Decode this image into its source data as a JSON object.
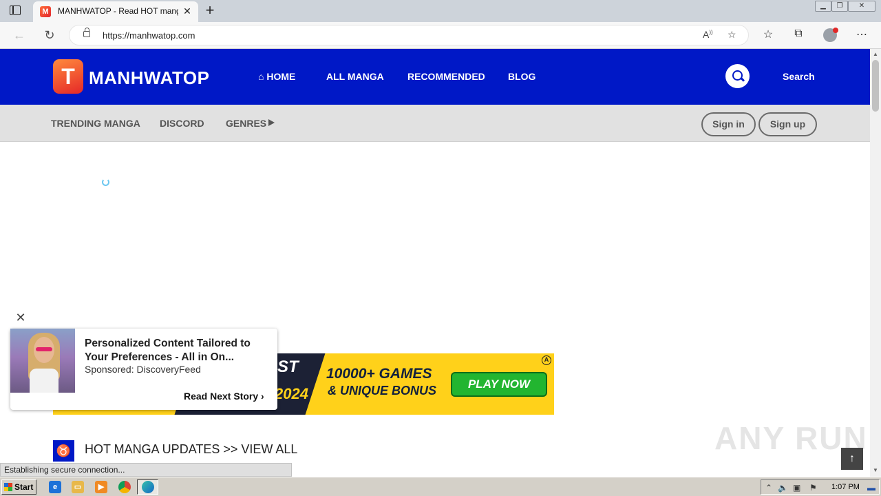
{
  "browser": {
    "tab_title": "MANHWATOP - Read HOT manga",
    "tab_favicon": "M",
    "url": "https://manhwatop.com",
    "icons": [
      "tab-list-icon",
      "close-icon",
      "plus-icon",
      "back-icon",
      "reload-icon",
      "lock-icon",
      "read-aloud-icon",
      "add-favorite-icon",
      "favorites-icon",
      "collections-icon",
      "profile-icon",
      "more-icon"
    ]
  },
  "site": {
    "logo_mark": "T",
    "logo_text": "MANHWATOP",
    "nav": {
      "home": "HOME",
      "all_manga": "ALL MANGA",
      "recommended": "RECOMMENDED",
      "blog": "BLOG"
    },
    "search_label": "Search",
    "subnav": {
      "trending": "TRENDING MANGA",
      "discord": "DISCORD",
      "genres": "GENRES"
    },
    "sign_in": "Sign in",
    "sign_up": "Sign up",
    "section_title": "HOT MANGA UPDATES >> VIEW ALL",
    "colors": {
      "brand_blue": "#0018c6",
      "subnav_gray": "#e1e1e1"
    }
  },
  "banner_ad": {
    "text_st": "ST",
    "text_year": "2024",
    "line1": "10000+ GAMES",
    "line2": "& UNIQUE BONUS",
    "cta": "PLAY NOW",
    "ad_mark": "A"
  },
  "popup_ad": {
    "headline": "Personalized Content Tailored to Your Preferences - All in On...",
    "sponsor": "Sponsored: DiscoveryFeed",
    "cta": "Read Next Story"
  },
  "watermark": "ANY RUN",
  "status_text": "Establishing secure connection...",
  "taskbar": {
    "start_label": "Start",
    "clock": "1:07 PM"
  }
}
